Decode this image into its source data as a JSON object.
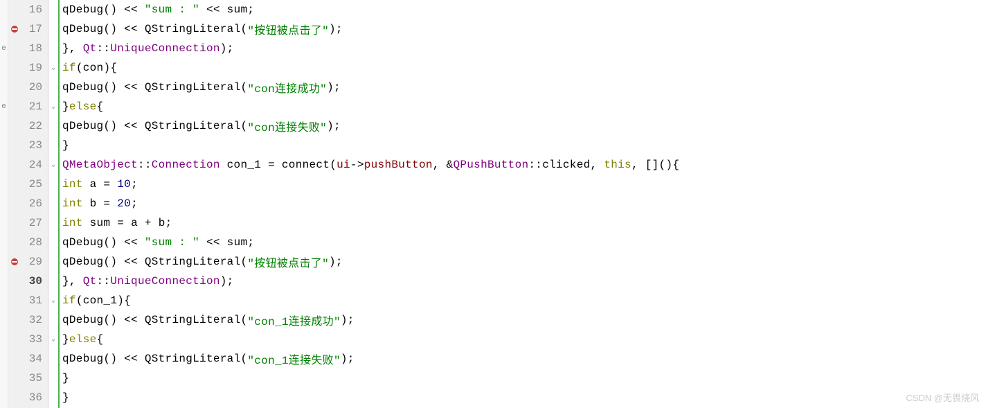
{
  "watermark": "CSDN @无畏烧风",
  "left_margin_chars": [
    "",
    "",
    "e",
    "",
    "",
    "e",
    "",
    "",
    "",
    "",
    "",
    "",
    "",
    "",
    "",
    "",
    "",
    "",
    "",
    "",
    ""
  ],
  "lines": [
    {
      "num": "16",
      "fold": "",
      "bp": false
    },
    {
      "num": "17",
      "fold": "",
      "bp": true
    },
    {
      "num": "18",
      "fold": "",
      "bp": false
    },
    {
      "num": "19",
      "fold": "v",
      "bp": false
    },
    {
      "num": "20",
      "fold": "",
      "bp": false
    },
    {
      "num": "21",
      "fold": "v",
      "bp": false
    },
    {
      "num": "22",
      "fold": "",
      "bp": false
    },
    {
      "num": "23",
      "fold": "",
      "bp": false
    },
    {
      "num": "24",
      "fold": "v",
      "bp": false
    },
    {
      "num": "25",
      "fold": "",
      "bp": false
    },
    {
      "num": "26",
      "fold": "",
      "bp": false
    },
    {
      "num": "27",
      "fold": "",
      "bp": false
    },
    {
      "num": "28",
      "fold": "",
      "bp": false
    },
    {
      "num": "29",
      "fold": "",
      "bp": true
    },
    {
      "num": "30",
      "fold": "",
      "bp": false,
      "current": true
    },
    {
      "num": "31",
      "fold": "v",
      "bp": false
    },
    {
      "num": "32",
      "fold": "",
      "bp": false
    },
    {
      "num": "33",
      "fold": "v",
      "bp": false
    },
    {
      "num": "34",
      "fold": "",
      "bp": false
    },
    {
      "num": "35",
      "fold": "",
      "bp": false
    },
    {
      "num": "36",
      "fold": "",
      "bp": false
    }
  ],
  "code": {
    "t_qDebug": "qDebug",
    "t_QStringLiteral": "QStringLiteral",
    "t_Qt": "Qt",
    "t_UniqueConnection": "UniqueConnection",
    "t_QMetaObject": "QMetaObject",
    "t_Connection": "Connection",
    "t_connect": "connect",
    "t_pushButton": "pushButton",
    "t_QPushButton": "QPushButton",
    "t_clicked": "clicked",
    "t_this": "this",
    "t_int": "int",
    "t_if": "if",
    "t_else": "else",
    "t_sum": "sum",
    "t_a": "a",
    "t_b": "b",
    "t_con": "con",
    "t_con_1": "con_1",
    "t_ui": "ui",
    "n_10": "10",
    "n_20": "20",
    "s_sumlabel": "\"sum : \"",
    "s_clicked": "\"按钮被点击了\"",
    "s_con_ok": "\"con连接成功\"",
    "s_con_fail": "\"con连接失败\"",
    "s_con1_ok": "\"con_1连接成功\"",
    "s_con1_fail": "\"con_1连接失败\""
  }
}
